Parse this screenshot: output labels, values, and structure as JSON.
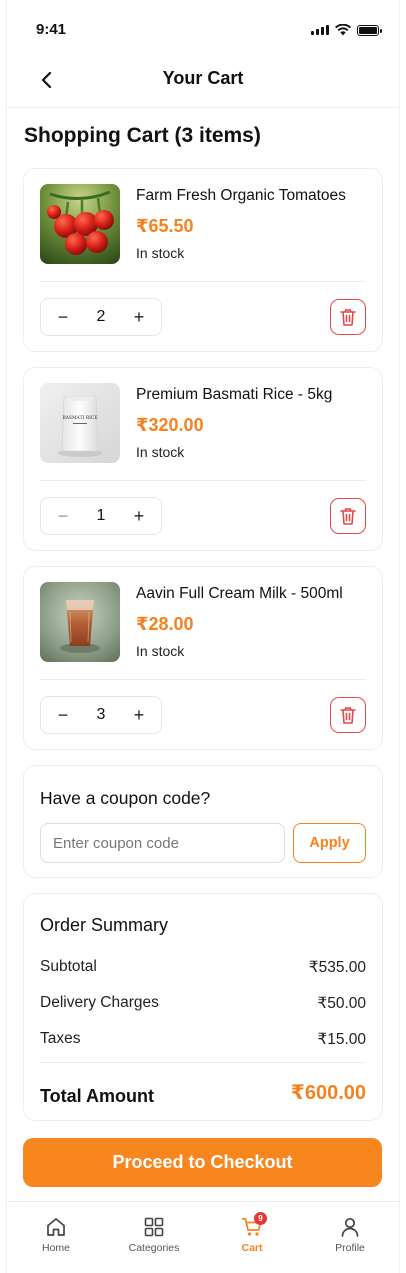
{
  "status_bar": {
    "time": "9:41"
  },
  "header": {
    "title": "Your Cart"
  },
  "page": {
    "title": "Shopping Cart (3 items)"
  },
  "cart": {
    "items": [
      {
        "name": "Farm Fresh Organic Tomatoes",
        "price": "₹65.50",
        "stock": "In stock",
        "quantity": "2",
        "image": "tomatoes"
      },
      {
        "name": "Premium Basmati Rice - 5kg",
        "price": "₹320.00",
        "stock": "In stock",
        "quantity": "1",
        "image": "rice-bag",
        "image_text": "BASMATI RICE"
      },
      {
        "name": "Aavin Full Cream Milk - 500ml",
        "price": "₹28.00",
        "stock": "In stock",
        "quantity": "3",
        "image": "milk-glass"
      }
    ],
    "decrement_symbol": "−",
    "increment_symbol": "+"
  },
  "coupon": {
    "title": "Have a coupon code?",
    "placeholder": "Enter coupon code",
    "apply_label": "Apply"
  },
  "summary": {
    "title": "Order Summary",
    "rows": [
      {
        "label": "Subtotal",
        "value": "₹535.00"
      },
      {
        "label": "Delivery Charges",
        "value": "₹50.00"
      },
      {
        "label": "Taxes",
        "value": "₹15.00"
      }
    ],
    "total_label": "Total Amount",
    "total_value": "₹600.00"
  },
  "checkout": {
    "label": "Proceed to Checkout"
  },
  "nav": {
    "items": [
      {
        "label": "Home",
        "icon": "home-icon"
      },
      {
        "label": "Categories",
        "icon": "grid-icon"
      },
      {
        "label": "Cart",
        "icon": "cart-icon",
        "badge": "9",
        "active": true
      },
      {
        "label": "Profile",
        "icon": "user-icon"
      }
    ]
  },
  "colors": {
    "accent": "#f5821f",
    "delete": "#e04848",
    "badge": "#e53935"
  }
}
